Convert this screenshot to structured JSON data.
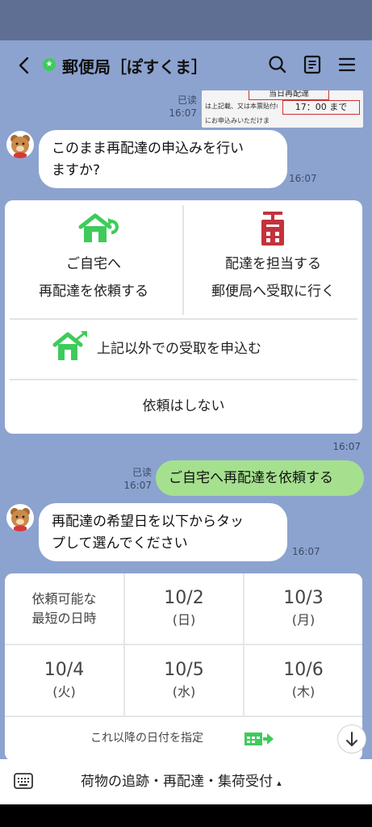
{
  "header": {
    "title": "郵便局［ぽすくま］"
  },
  "thumbnail": {
    "read": "已读",
    "time": "16:07",
    "snippet_line1": "当日再配達",
    "snippet_line2": "は上記載、又は本票貼付のシール",
    "snippet_time": "17：00 まで",
    "snippet_line3": "にお申込みいただけま"
  },
  "messages": {
    "q1": {
      "text_line1": "このまま再配達の申込みを行い",
      "text_line2": "ますか?",
      "time": "16:07"
    },
    "reply": {
      "read": "已读",
      "time": "16:07",
      "text": "ご自宅へ再配達を依頼する"
    },
    "q2": {
      "text_line1": "再配達の希望日を以下からタッ",
      "text_line2": "プして選んでください",
      "time": "16:07"
    }
  },
  "options_card": {
    "home_line1": "ご自宅へ",
    "home_line2": "再配達を依頼する",
    "office_line1": "配達を担当する",
    "office_line2": "郵便局へ受取に行く",
    "other": "上記以外での受取を申込む",
    "none": "依頼はしない",
    "time": "16:07"
  },
  "date_card": {
    "earliest_line1": "依頼可能な",
    "earliest_line2": "最短の日時",
    "dates": [
      {
        "date": "10/2",
        "day": "(日)"
      },
      {
        "date": "10/3",
        "day": "(月)"
      },
      {
        "date": "10/4",
        "day": "(火)"
      },
      {
        "date": "10/5",
        "day": "(水)"
      },
      {
        "date": "10/6",
        "day": "(木)"
      }
    ],
    "later": "これ以降の日付を指定"
  },
  "bottom_menu": {
    "label": "荷物の追跡・再配達・集荷受付",
    "caret": "▴"
  },
  "colors": {
    "background": "#8ca3d0",
    "sent_bubble": "#a5e08f",
    "home_icon": "#3ecb5a",
    "post_icon": "#c4323c"
  },
  "icons": [
    "back-chevron-icon",
    "star-badge-icon",
    "search-icon",
    "notes-icon",
    "menu-icon",
    "home-redeliver-icon",
    "post-box-icon",
    "home-send-icon",
    "calendar-arrow-icon",
    "arrow-down-icon",
    "keyboard-icon"
  ]
}
